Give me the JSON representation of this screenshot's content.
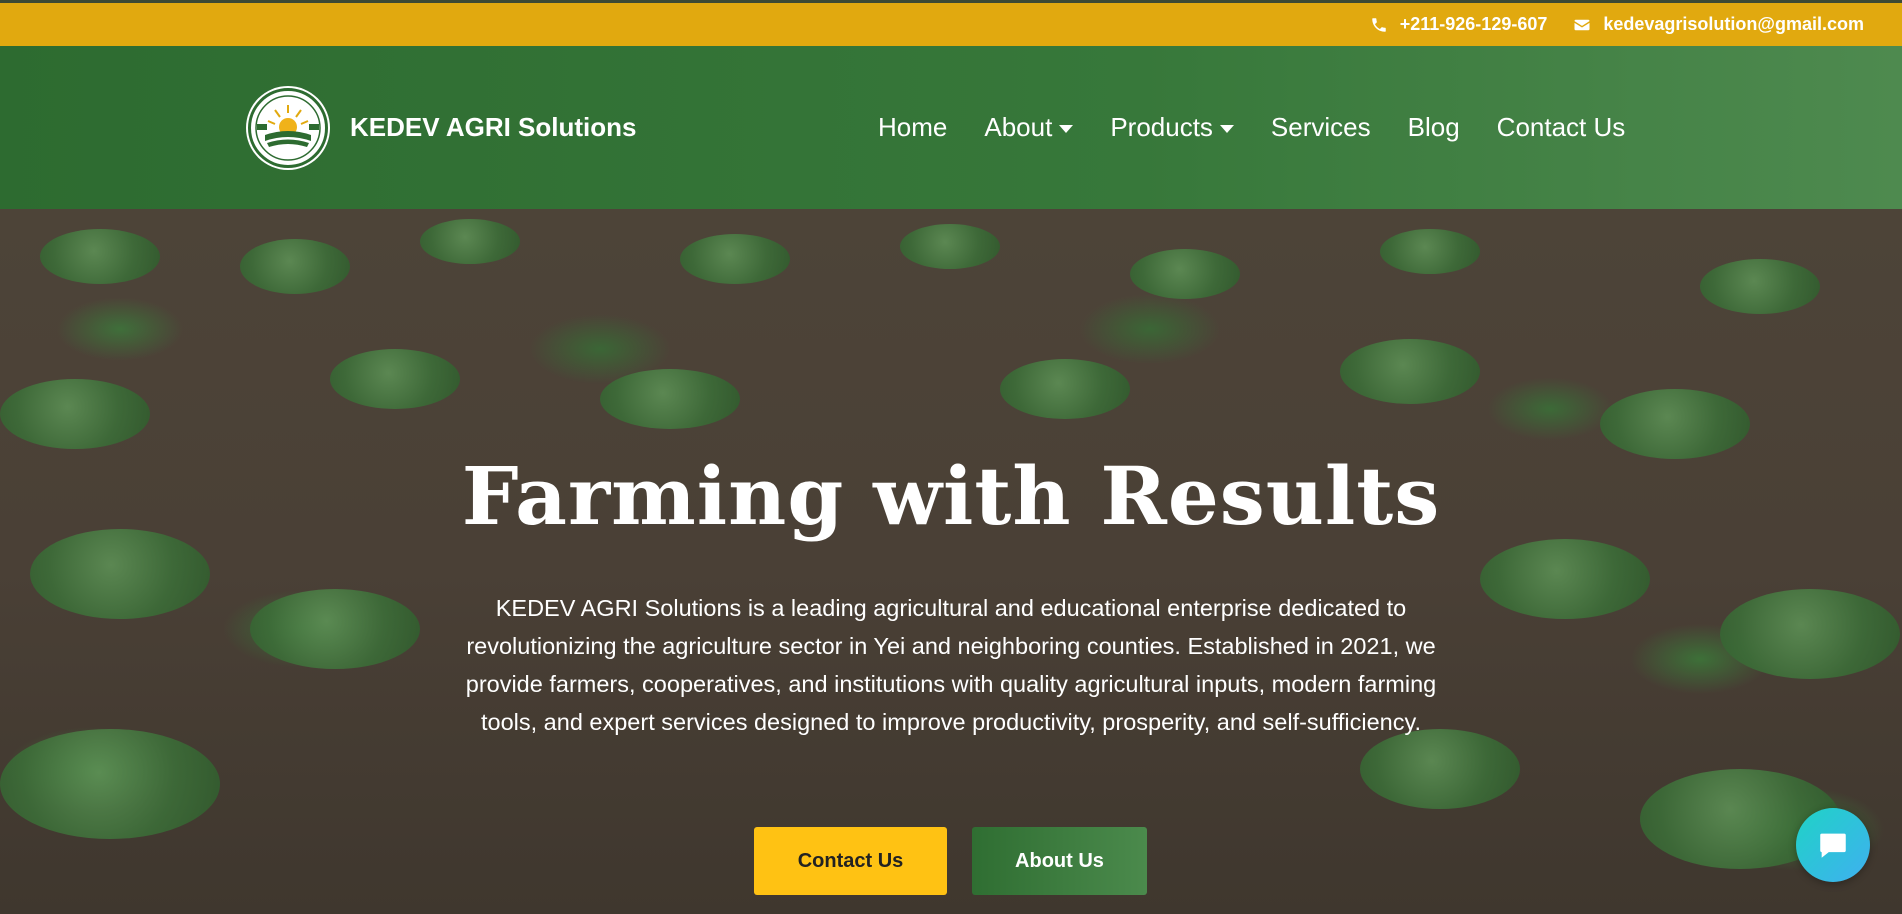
{
  "topbar": {
    "phone": "+211-926-129-607",
    "email": "kedevagrisolution@gmail.com",
    "phone_icon": "phone-icon",
    "email_icon": "envelope-icon"
  },
  "header": {
    "brand": "KEDEV AGRI Solutions",
    "logo_icon": "sun-field-logo",
    "nav": [
      {
        "label": "Home"
      },
      {
        "label": "About"
      },
      {
        "label": "Products"
      },
      {
        "label": "Services"
      },
      {
        "label": "Blog"
      },
      {
        "label": "Contact Us"
      }
    ]
  },
  "hero": {
    "title": "Farming with Results",
    "description": "KEDEV AGRI Solutions is a leading agricultural and educational enterprise dedicated to revolutionizing the agriculture sector in Yei and neighboring counties. Established in 2021, we provide farmers, cooperatives, and institutions with quality agricultural inputs, modern farming tools, and expert services designed to improve productivity, prosperity, and self-sufficiency.",
    "contact_button": "Contact Us",
    "about_button": "About Us"
  },
  "chat_icon": "chat-bubble-icon",
  "colors": {
    "topbar": "#e1a90f",
    "header_green": "#2d6b30",
    "button_yellow": "#ffc213",
    "chat": "#1fd3c6"
  }
}
